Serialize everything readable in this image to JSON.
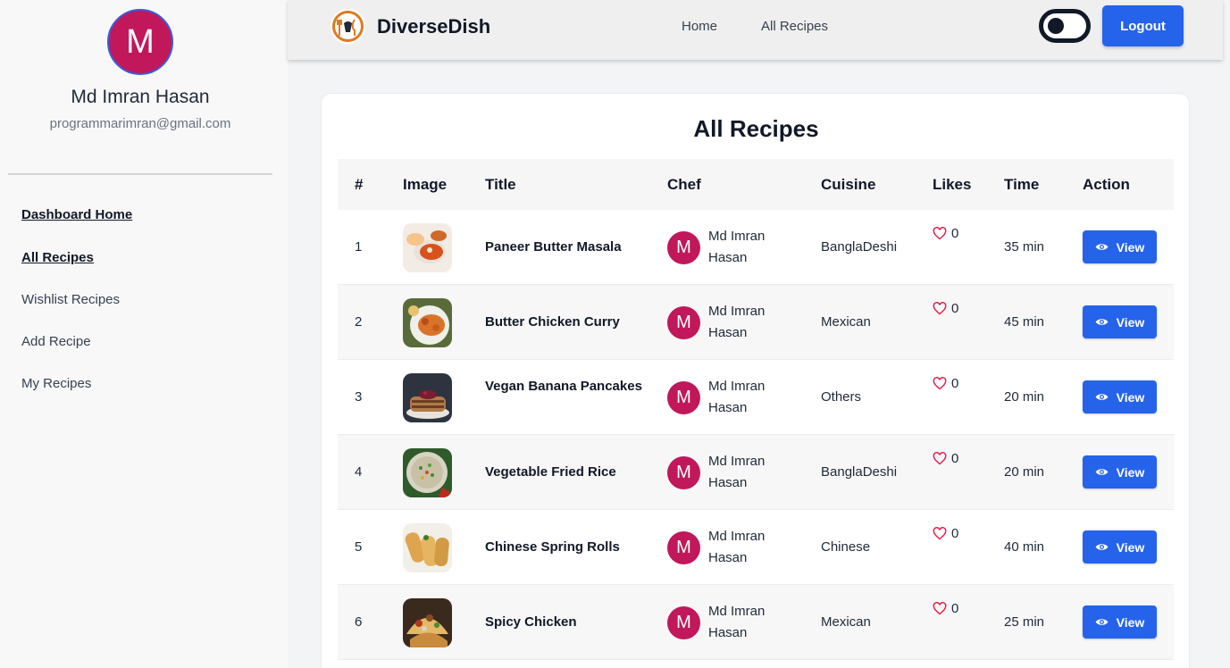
{
  "sidebar": {
    "avatar_letter": "M",
    "user_name": "Md Imran Hasan",
    "user_email": "programmarimran@gmail.com",
    "items": [
      {
        "label": "Dashboard Home",
        "active": true
      },
      {
        "label": "All Recipes",
        "active": true
      },
      {
        "label": "Wishlist Recipes",
        "active": false
      },
      {
        "label": "Add Recipe",
        "active": false
      },
      {
        "label": "My Recipes",
        "active": false
      }
    ]
  },
  "header": {
    "brand": "DiverseDish",
    "links": [
      "Home",
      "All Recipes"
    ],
    "logout_label": "Logout",
    "theme_toggle": "off"
  },
  "main": {
    "title": "All Recipes",
    "columns": [
      "#",
      "Image",
      "Title",
      "Chef",
      "Cuisine",
      "Likes",
      "Time",
      "Action"
    ],
    "rows": [
      {
        "num": "1",
        "title": "Paneer Butter Masala",
        "chef_letter": "M",
        "chef": "Md Imran Hasan",
        "cuisine": "BanglaDeshi",
        "likes": "0",
        "time": "35 min",
        "action": "View"
      },
      {
        "num": "2",
        "title": "Butter Chicken Curry",
        "chef_letter": "M",
        "chef": "Md Imran Hasan",
        "cuisine": "Mexican",
        "likes": "0",
        "time": "45 min",
        "action": "View"
      },
      {
        "num": "3",
        "title": "Vegan Banana Pancakes",
        "chef_letter": "M",
        "chef": "Md Imran Hasan",
        "cuisine": "Others",
        "likes": "0",
        "time": "20 min",
        "action": "View"
      },
      {
        "num": "4",
        "title": "Vegetable Fried Rice",
        "chef_letter": "M",
        "chef": "Md Imran Hasan",
        "cuisine": "BanglaDeshi",
        "likes": "0",
        "time": "20 min",
        "action": "View"
      },
      {
        "num": "5",
        "title": "Chinese Spring Rolls",
        "chef_letter": "M",
        "chef": "Md Imran Hasan",
        "cuisine": "Chinese",
        "likes": "0",
        "time": "40 min",
        "action": "View"
      },
      {
        "num": "6",
        "title": "Spicy Chicken",
        "chef_letter": "M",
        "chef": "Md Imran Hasan",
        "cuisine": "Mexican",
        "likes": "0",
        "time": "25 min",
        "action": "View"
      }
    ]
  },
  "colors": {
    "accent": "#2563eb",
    "avatar": "#c0185a",
    "heart": "#e11d48"
  }
}
